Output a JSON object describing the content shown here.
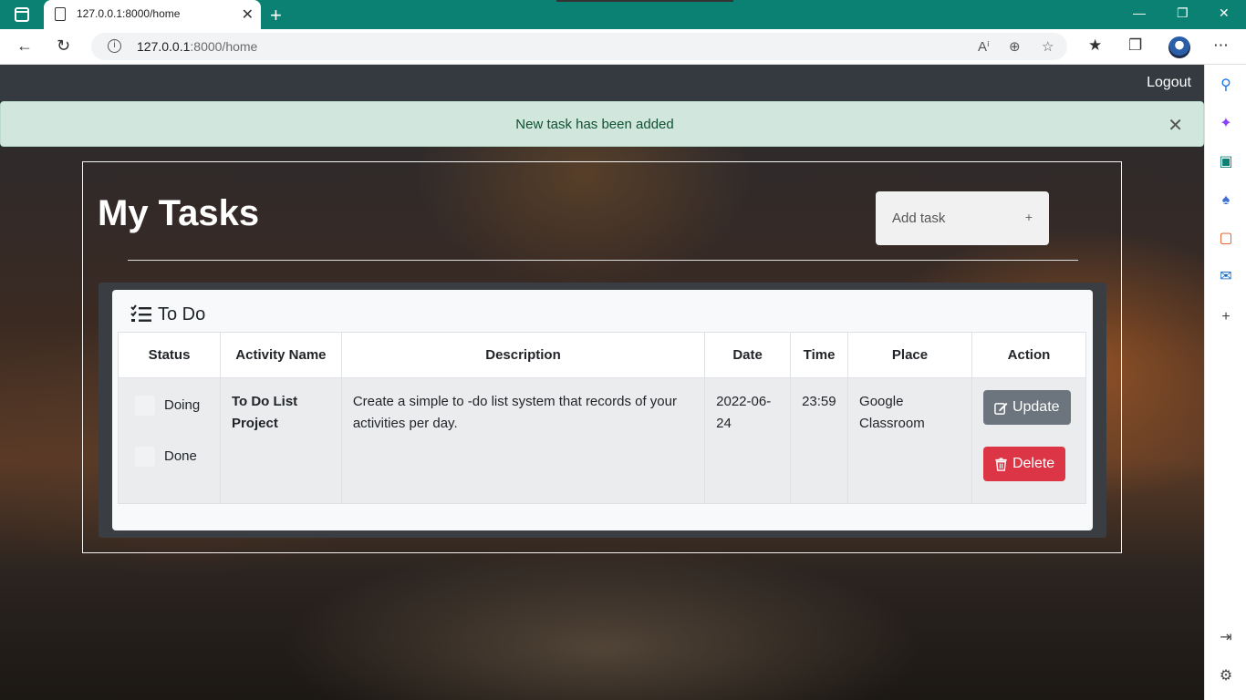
{
  "browser": {
    "tab_title": "127.0.0.1:8000/home",
    "tab_close": "✕",
    "new_tab": "+",
    "url_host": "127.0.0.1",
    "url_path": ":8000/home",
    "window_controls": [
      "—",
      "❐",
      "✕"
    ]
  },
  "navbar": {
    "logout": "Logout"
  },
  "alert": {
    "message": "New task has been added",
    "close": "✕"
  },
  "header": {
    "title": "My Tasks",
    "add_task_placeholder": "Add task",
    "add_task_plus": "+"
  },
  "card": {
    "title": "To Do",
    "columns": [
      "Status",
      "Activity Name",
      "Description",
      "Date",
      "Time",
      "Place",
      "Action"
    ],
    "rows": [
      {
        "status_options": [
          "Doing",
          "Done"
        ],
        "activity_name": "To Do List Project",
        "description": "Create a simple to -do list system that records of your activities per day.",
        "date": "2022-06-24",
        "time": "23:59",
        "place": "Google Classroom",
        "update_label": "Update",
        "delete_label": "Delete"
      }
    ]
  },
  "colors": {
    "titlebar": "#0b8174",
    "navbar": "#343a40",
    "alert_bg": "#d1e7dd",
    "alert_text": "#0f5132",
    "update_btn": "#6c757d",
    "delete_btn": "#dc3545"
  }
}
